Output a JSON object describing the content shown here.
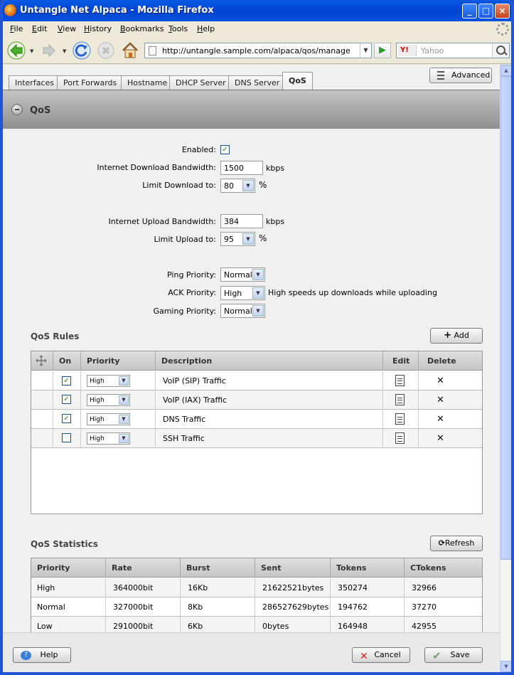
{
  "window": {
    "title": "Untangle Net Alpaca - Mozilla Firefox",
    "min": "_",
    "max": "□",
    "close": "×"
  },
  "menu": [
    "File",
    "Edit",
    "View",
    "History",
    "Bookmarks",
    "Tools",
    "Help"
  ],
  "nav": {
    "url": "http://untangle.sample.com/alpaca/qos/manage",
    "search_engine": "Y!",
    "search_placeholder": "Yahoo",
    "go": "▶"
  },
  "tabs": [
    "Interfaces",
    "Port Forwards",
    "Hostname",
    "DHCP Server",
    "DNS Server",
    "QoS"
  ],
  "active_tab": "QoS",
  "advanced_label": "Advanced",
  "panel_title": "QoS",
  "form": {
    "enabled_label": "Enabled:",
    "enabled": true,
    "check_glyph": "✓",
    "dl_bw_label": "Internet Download Bandwidth:",
    "dl_bw_value": "1500",
    "dl_bw_unit": "kbps",
    "dl_limit_label": "Limit Download to:",
    "dl_limit_value": "80",
    "dl_limit_unit": "%",
    "ul_bw_label": "Internet Upload Bandwidth:",
    "ul_bw_value": "384",
    "ul_bw_unit": "kbps",
    "ul_limit_label": "Limit Upload to:",
    "ul_limit_value": "95",
    "ul_limit_unit": "%",
    "ping_label": "Ping Priority:",
    "ping_value": "Normal",
    "ack_label": "ACK Priority:",
    "ack_value": "High",
    "ack_hint": "High speeds up downloads while uploading",
    "gaming_label": "Gaming Priority:",
    "gaming_value": "Normal"
  },
  "rules": {
    "title": "QoS Rules",
    "add_label": "Add",
    "headers": {
      "on": "On",
      "priority": "Priority",
      "description": "Description",
      "edit": "Edit",
      "delete": "Delete"
    },
    "delete_glyph": "✕",
    "rows": [
      {
        "on": true,
        "priority": "High",
        "description": "VoIP (SIP) Traffic"
      },
      {
        "on": true,
        "priority": "High",
        "description": "VoIP (IAX) Traffic"
      },
      {
        "on": true,
        "priority": "High",
        "description": "DNS Traffic"
      },
      {
        "on": false,
        "priority": "High",
        "description": "SSH Traffic"
      }
    ]
  },
  "stats": {
    "title": "QoS Statistics",
    "refresh_label": "Refresh",
    "headers": [
      "Priority",
      "Rate",
      "Burst",
      "Sent",
      "Tokens",
      "CTokens"
    ],
    "rows": [
      [
        "High",
        "364000bit",
        "16Kb",
        "21622521bytes",
        "350274",
        "32966"
      ],
      [
        "Normal",
        "327000bit",
        "8Kb",
        "286527629bytes",
        "194762",
        "37270"
      ],
      [
        "Low",
        "291000bit",
        "6Kb",
        "0bytes",
        "164948",
        "42955"
      ]
    ]
  },
  "footer": {
    "help_label": "Help",
    "cancel_label": "Cancel",
    "save_label": "Save"
  }
}
